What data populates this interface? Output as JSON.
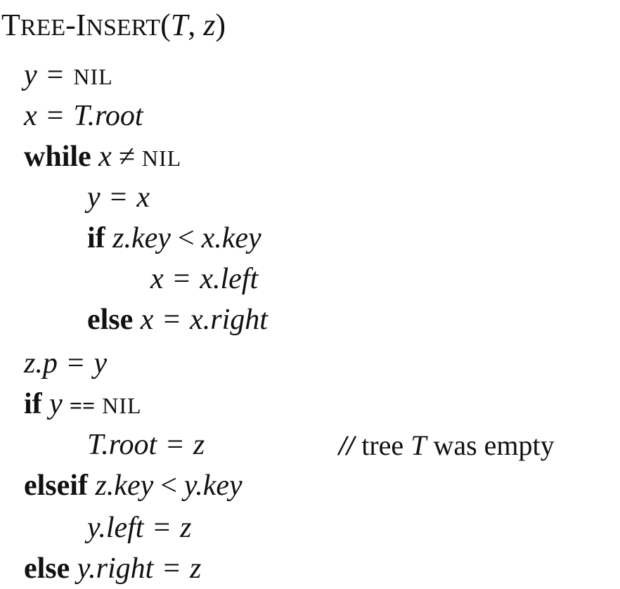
{
  "procedure": {
    "name_T": "T",
    "name_ree": "REE",
    "name_dash": "-",
    "name_I": "I",
    "name_nsert": "NSERT",
    "open_paren": "(",
    "arg1": "T",
    "comma": ", ",
    "arg2": "z",
    "close_paren": ")"
  },
  "lines": {
    "l1": {
      "lhs": "y",
      "op": "=",
      "rhs": "NIL"
    },
    "l2": {
      "lhs": "x",
      "op": "=",
      "rhs": "T.root"
    },
    "l3": {
      "kw": "while",
      "var": "x",
      "op": "≠",
      "rhs": "NIL"
    },
    "l4": {
      "lhs": "y",
      "op": "=",
      "rhs": "x"
    },
    "l5": {
      "kw": "if",
      "lhs": "z.key",
      "op": "<",
      "rhs": "x.key"
    },
    "l6": {
      "lhs": "x",
      "op": "=",
      "rhs": "x.left"
    },
    "l7": {
      "kw": "else",
      "lhs": "x",
      "op": "=",
      "rhs": "x.right"
    },
    "l8": {
      "lhs": "z.p",
      "op": "=",
      "rhs": "y"
    },
    "l9": {
      "kw": "if",
      "var": "y",
      "op": "==",
      "rhs": "NIL"
    },
    "l10": {
      "lhs": "T.root",
      "op": "=",
      "rhs": "z",
      "comment_mark": "//",
      "comment_pre": "tree",
      "comment_var": "T",
      "comment_post": "was empty"
    },
    "l11": {
      "kw": "elseif",
      "lhs": "z.key",
      "op": "<",
      "rhs": "y.key"
    },
    "l12": {
      "lhs": "y.left",
      "op": "=",
      "rhs": "z"
    },
    "l13": {
      "kw": "else",
      "lhs": "y.right",
      "op": "=",
      "rhs": "z"
    }
  }
}
